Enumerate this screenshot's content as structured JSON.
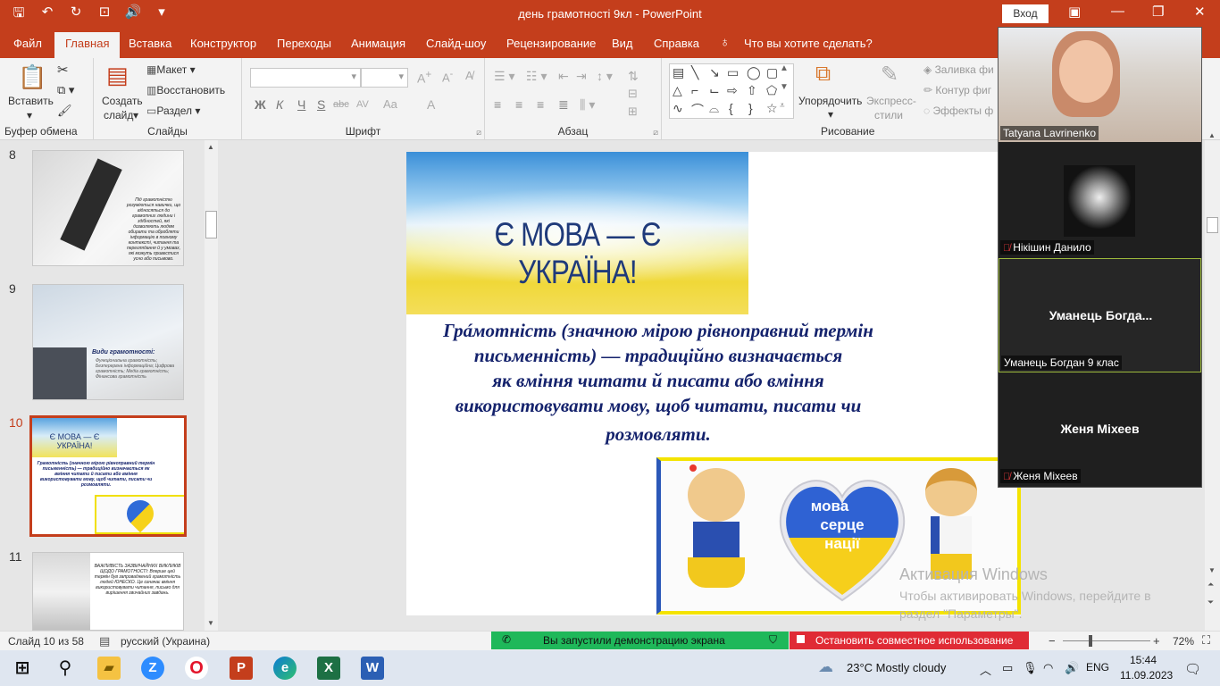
{
  "window": {
    "title": "день грамотності 9кл  -  PowerPoint",
    "signin": "Вход"
  },
  "tabs": [
    "Файл",
    "Главная",
    "Вставка",
    "Конструктор",
    "Переходы",
    "Анимация",
    "Слайд-шоу",
    "Рецензирование",
    "Вид",
    "Справка"
  ],
  "tell_me": "Что вы хотите сделать?",
  "ribbon": {
    "clipboard": {
      "paste": "Вставить",
      "label": "Буфер обмена"
    },
    "slides": {
      "new_slide_1": "Создать",
      "new_slide_2": "слайд",
      "layout": "Макет",
      "reset": "Восстановить",
      "section": "Раздел",
      "label": "Слайды"
    },
    "font": {
      "label": "Шрифт",
      "b": "Ж",
      "i": "К",
      "u": "Ч",
      "s": "S",
      "abc": "abc",
      "av": "AV",
      "aa": "Aa",
      "a": "A"
    },
    "paragraph": {
      "label": "Абзац"
    },
    "drawing": {
      "arrange_1": "Упорядочить",
      "express_1": "Экспресс-",
      "express_2": "стили",
      "fill": "Заливка фи",
      "outline": "Контур фиг",
      "effects": "Эффекты ф",
      "label": "Рисование"
    }
  },
  "thumbnails": [
    {
      "num": "8",
      "text": "Під грамотністю розуміються навички, що відносяться до грамотних людини і здібностей, які дозволяють людям обирати та обробляти інформацію в повному контексті, читання та переглядання й у умовах, які можуть привестися усно або письмово."
    },
    {
      "num": "9",
      "title": "Види грамотності:",
      "text": "Функціональна грамотність; Безперервна інформаційна; Цифрова грамотність; Медіа грамотність; Фінансова грамотність"
    },
    {
      "num": "10",
      "banner": "Є МОВА — Є УКРАЇНА!",
      "text": "Грамотність (значною мірою рівноправний термін письменність) — традиційно визначається як вміння читати й писати або вміння використовувати мову, щоб читати, писати чи розмовляти."
    },
    {
      "num": "11",
      "text": "ВАЖЛИВІСТЬ ЗАЗВИЧАЙНИХ ВИКЛИКІВ ЩОДО ГРАМОТНОСТІ: Вперше цей термін був запроваджений грамотність людей ЮНЕСКО. Це означає вміння використовувати читання, письмо для вирішення звичайних завдань."
    }
  ],
  "slide": {
    "banner_text": "Є МОВА — Є УКРАЇНА!",
    "body_lines": [
      "Грáмотність (значною мірою рівноправний термін",
      "письменність) — традиційно визначається",
      "як вміння читати й писати або вміння",
      "використовувати мову, щоб читати, писати чи",
      "розмовляти."
    ],
    "heart_words": [
      "мова",
      "серце",
      "нації"
    ]
  },
  "meeting": {
    "p1": "Tatyana Lavrinenko",
    "p2": "Нікішин Данило",
    "p3_big": "Уманець  Богда...",
    "p3": "Уманець Богдан 9 клас",
    "p4_big": "Женя Міхеев",
    "p4": "Женя Міхеев"
  },
  "watermark": {
    "line1": "Активация Windows",
    "line2": "Чтобы активировать Windows, перейдите в раздел \"Параметры\"."
  },
  "status": {
    "slide": "Слайд 10 из 58",
    "lang": "русский (Украина)",
    "share": "Вы запустили демонстрацию экрана",
    "stop": "Остановить совместное использование",
    "zoom": "72%"
  },
  "taskbar": {
    "weather": "23°C  Mostly cloudy",
    "lang": "ENG",
    "time": "15:44",
    "date": "11.09.2023"
  }
}
